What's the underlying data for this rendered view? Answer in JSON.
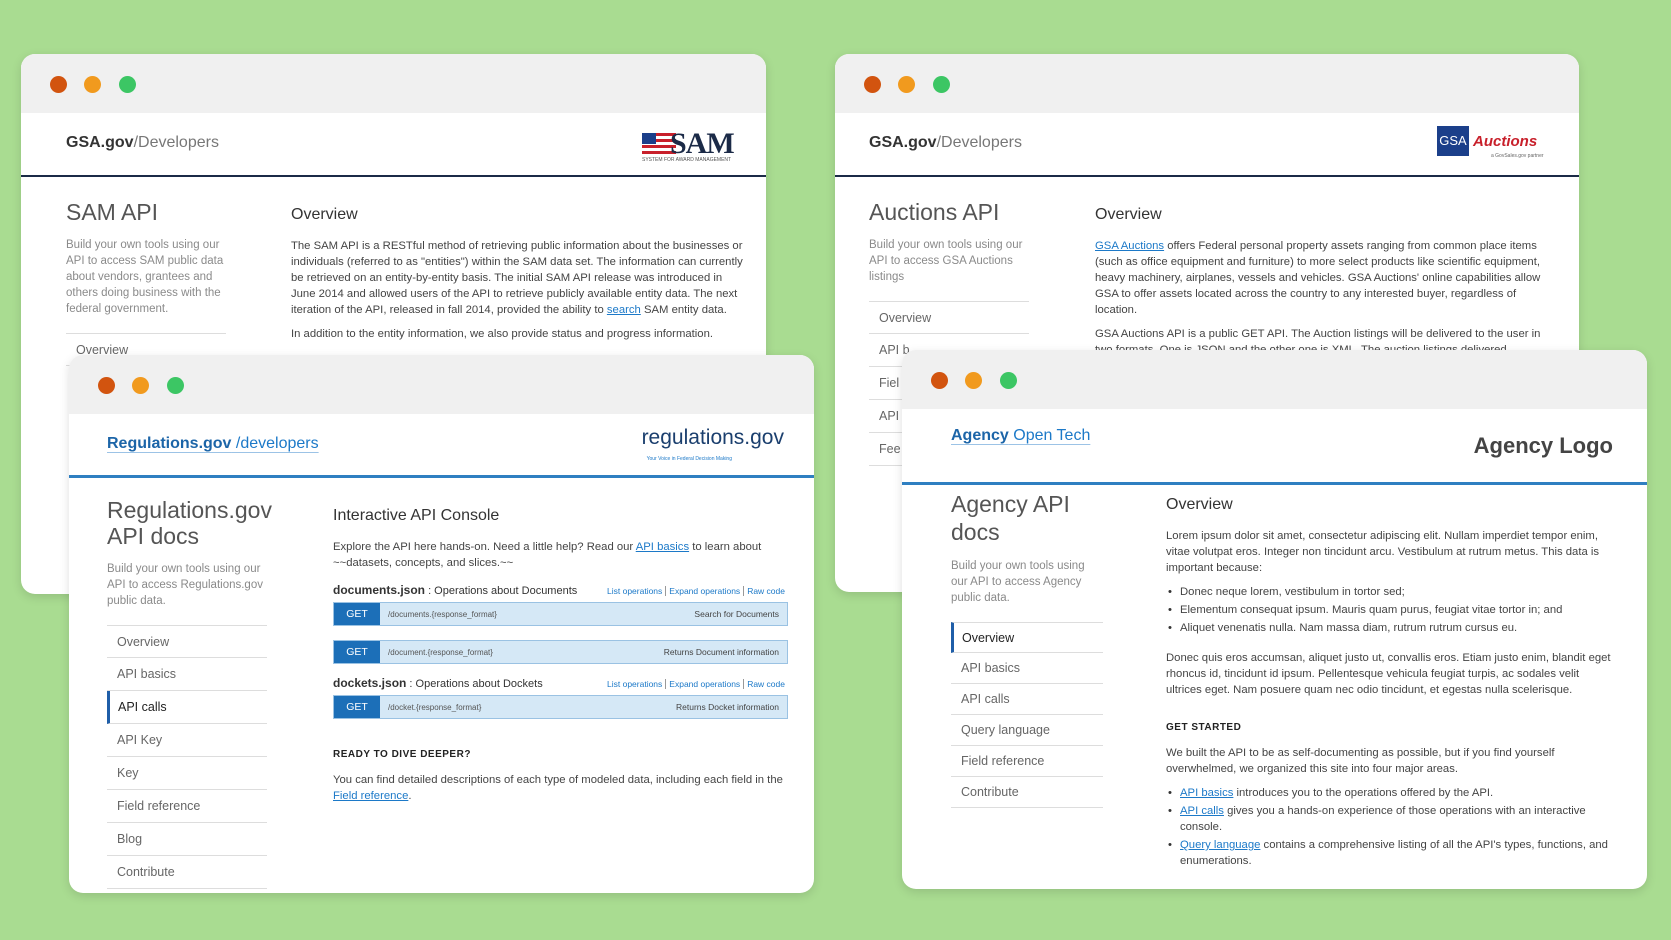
{
  "windows": {
    "sam": {
      "site_bold": "GSA.gov",
      "site_light": "/Developers",
      "logo_text": "SAM",
      "logo_sub": "SYSTEM FOR AWARD MANAGEMENT",
      "title": "SAM API",
      "intro": "Build your own tools using our API to access SAM public data about vendors, grantees and others doing business with the federal government.",
      "nav": [
        "Overview"
      ],
      "heading": "Overview",
      "p1_before": "The SAM API is a RESTful method of retrieving public information about the businesses or individuals (referred to as \"entities\") within the SAM data set. The information can currently be retrieved on an entity-by-entity basis. The initial SAM API release was introduced in June 2014 and allowed users of the API to retrieve publicly available entity data. The next iteration of the API, released in fall 2014, provided the ability to ",
      "p1_link": "search",
      "p1_after": " SAM entity data.",
      "p2": "In addition to the entity information, we also provide status and progress information."
    },
    "auctions": {
      "site_bold": "GSA.gov",
      "site_light": "/Developers",
      "logo_gsa": "GSA",
      "logo_auctions": "Auctions",
      "logo_sub": "a GovSales.gov partner",
      "title": "Auctions API",
      "intro": "Build your own tools using our API to access GSA Auctions listings",
      "nav": [
        "Overview",
        "API b",
        "Fiel",
        "API",
        "Fee"
      ],
      "heading": "Overview",
      "p1_link": "GSA Auctions",
      "p1_after": " offers Federal personal property assets ranging from common place items (such as office equipment and furniture) to more select products like scientific equipment, heavy machinery, airplanes, vessels and vehicles. GSA Auctions' online capabilities allow GSA to offer assets located across the country to any interested buyer, regardless of location.",
      "p2": "GSA Auctions API is a public GET API. The Auction listings will be delivered to the user in two formats. One is JSON and the other one is XML. The auction listings delivered"
    },
    "regulations": {
      "site_bold": "Regulations.gov",
      "site_light": " /developers",
      "logo_text": "regulations.gov",
      "logo_sub": "Your Voice in Federal Decision Making",
      "title": "Regulations.gov API docs",
      "intro": "Build your own tools using our API to access Regulations.gov public data.",
      "nav": [
        "Overview",
        "API basics",
        "API calls",
        "API Key",
        "Key",
        "Field reference",
        "Blog",
        "Contribute"
      ],
      "heading": "Interactive API Console",
      "p1_before": "Explore the API here hands-on. Need a little help? Read our ",
      "p1_link": "API basics",
      "p1_after": " to learn about ~~datasets, concepts, and slices.~~",
      "groups": [
        {
          "name": "documents.json",
          "desc": " : Operations about Documents",
          "links": [
            "List operations",
            "Expand operations",
            "Raw code"
          ],
          "rows": [
            {
              "method": "GET",
              "path": "/documents.{response_format}",
              "desc": "Search for Documents"
            },
            {
              "method": "GET",
              "path": "/document.{response_format}",
              "desc": "Returns Document information"
            }
          ]
        },
        {
          "name": "dockets.json",
          "desc": " : Operations about Dockets",
          "links": [
            "List operations",
            "Expand operations",
            "Raw code"
          ],
          "rows": [
            {
              "method": "GET",
              "path": "/docket.{response_format}",
              "desc": "Returns Docket information"
            }
          ]
        }
      ],
      "deeper_heading": "READY TO DIVE DEEPER?",
      "deeper_before": "You can find detailed descriptions of each type of modeled data, including each field in the ",
      "deeper_link": "Field reference",
      "deeper_after": "."
    },
    "agency": {
      "site_bold": "Agency",
      "site_light": " Open Tech",
      "logo_text": "Agency Logo",
      "title": "Agency API docs",
      "intro": "Build your own tools using our API to access Agency public data.",
      "nav": [
        "Overview",
        "API basics",
        "API calls",
        "Query language",
        "Field reference",
        "Contribute"
      ],
      "heading": "Overview",
      "p1": "Lorem ipsum dolor sit amet, consectetur adipiscing elit. Nullam imperdiet tempor enim, vitae volutpat eros. Integer non tincidunt arcu. Vestibulum at rutrum metus. This data is important because:",
      "bullets": [
        "Donec neque lorem, vestibulum in tortor sed;",
        "Elementum consequat ipsum. Mauris quam purus, feugiat vitae tortor in; and",
        "Aliquet venenatis nulla. Nam massa diam, rutrum rutrum cursus eu."
      ],
      "p2": "Donec quis eros accumsan, aliquet justo ut, convallis eros. Etiam justo enim, blandit eget rhoncus id, tincidunt id ipsum. Pellentesque vehicula feugiat turpis, ac sodales velit ultrices eget. Nam posuere quam nec odio tincidunt, et egestas nulla scelerisque.",
      "started_heading": "GET STARTED",
      "p3": "We built the API to be as self-documenting as possible, but if you find yourself overwhelmed, we organized this site into four major areas.",
      "links": [
        {
          "link": "API basics",
          "text": " introduces you to the operations offered by the API."
        },
        {
          "link": "API calls",
          "text": " gives you a hands-on experience of those operations with an interactive console."
        },
        {
          "link": "Query language",
          "text": " contains a comprehensive listing of all the API's types, functions, and enumerations."
        }
      ]
    }
  },
  "colors": {
    "background": "#a9dc91",
    "navy": "#1b2a47",
    "link": "#1c79c8",
    "accent": "#2f7fc1"
  }
}
